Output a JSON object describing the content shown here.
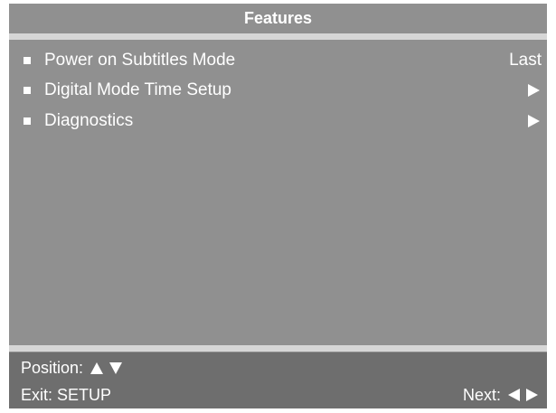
{
  "menu": {
    "title": "Features",
    "items": [
      {
        "label": "Power on Subtitles Mode",
        "value": "Last",
        "indicator": ""
      },
      {
        "label": "Digital Mode Time Setup",
        "value": "",
        "indicator": "arrow-right-icon"
      },
      {
        "label": "Diagnostics",
        "value": "",
        "indicator": "arrow-right-icon"
      }
    ]
  },
  "footer": {
    "position_label": "Position:",
    "position_icons": [
      "arrow-up-icon",
      "arrow-down-icon"
    ],
    "exit_label": "Exit: SETUP",
    "next_label": "Next:",
    "next_icons": [
      "arrow-left-icon",
      "arrow-right-icon"
    ]
  },
  "colors": {
    "panel_background": "#909090",
    "footer_background": "#6e6e6e",
    "divider": "#d6d6d6",
    "text": "#ffffff"
  }
}
